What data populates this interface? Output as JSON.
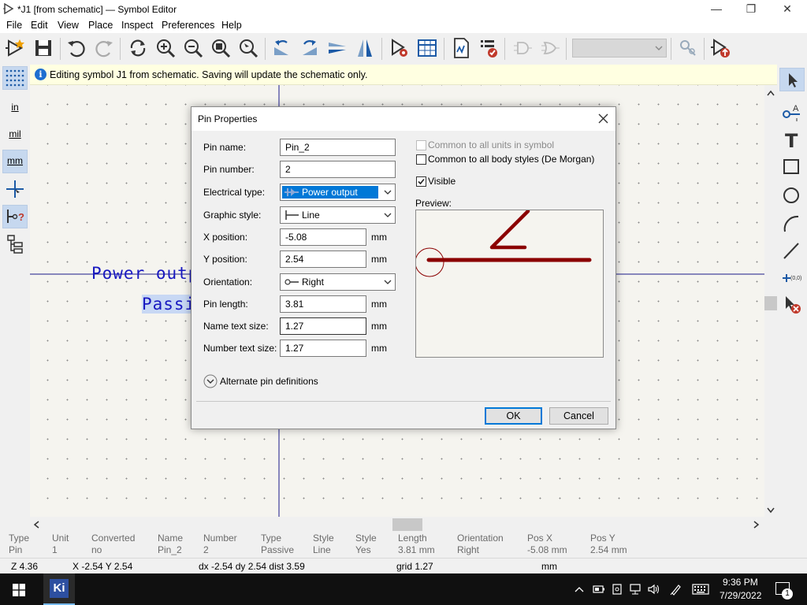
{
  "window": {
    "title": "*J1 [from schematic] — Symbol Editor",
    "controls": [
      "—",
      "❐",
      "✕"
    ]
  },
  "menu": [
    "File",
    "Edit",
    "View",
    "Place",
    "Inspect",
    "Preferences",
    "Help"
  ],
  "toolbar": {
    "unit_select_value": "",
    "icons": [
      "new-symbol-icon",
      "save-icon",
      "undo-icon",
      "redo-icon",
      "refresh-icon",
      "zoom-in-icon",
      "zoom-out-icon",
      "zoom-fit-icon",
      "zoom-tool-icon",
      "rotate-ccw-icon",
      "rotate-cw-icon",
      "mirror-v-icon",
      "mirror-h-icon",
      "symbol-properties-icon",
      "pin-table-icon",
      "datasheet-icon",
      "check-icon",
      "de-morgan-standard-icon",
      "de-morgan-alternate-icon",
      "sync-pins-icon",
      "update-schematic-icon"
    ]
  },
  "left_toolbar": {
    "grid_label": "",
    "inch_label": "in",
    "mil_label": "mil",
    "mm_label": "mm"
  },
  "infobar": {
    "icon": "i",
    "message": "Editing symbol J1 from schematic.  Saving will update the schematic only."
  },
  "canvas": {
    "pin_type_text": "Power outp",
    "pin_style_text": "Passi"
  },
  "dialog": {
    "title": "Pin Properties",
    "pin_name_label": "Pin name:",
    "pin_name_value": "Pin_2",
    "pin_number_label": "Pin number:",
    "pin_number_value": "2",
    "electrical_type_label": "Electrical type:",
    "electrical_type_value": "Power output",
    "graphic_style_label": "Graphic style:",
    "graphic_style_value": "Line",
    "x_position_label": "X position:",
    "x_position_value": "-5.08",
    "y_position_label": "Y position:",
    "y_position_value": "2.54",
    "orientation_label": "Orientation:",
    "orientation_value": "Right",
    "pin_length_label": "Pin length:",
    "pin_length_value": "3.81",
    "name_text_size_label": "Name text size:",
    "name_text_size_value": "1.27",
    "number_text_size_label": "Number text size:",
    "number_text_size_value": "1.27",
    "unit": "mm",
    "common_units_label": "Common to all units in symbol",
    "common_units_checked": false,
    "common_styles_label": "Common to all body styles (De Morgan)",
    "common_styles_checked": false,
    "visible_label": "Visible",
    "visible_checked": true,
    "preview_label": "Preview:",
    "alternate_label": "Alternate pin definitions",
    "ok_label": "OK",
    "cancel_label": "Cancel",
    "pin_color": "#8b0000"
  },
  "message_panel": {
    "columns": [
      {
        "header": "Type",
        "value": "Pin"
      },
      {
        "header": "Unit",
        "value": "1"
      },
      {
        "header": "Converted",
        "value": "no"
      },
      {
        "header": "Name",
        "value": "Pin_2"
      },
      {
        "header": "Number",
        "value": "2"
      },
      {
        "header": "Type",
        "value": "Passive"
      },
      {
        "header": "Style",
        "value": "Line"
      },
      {
        "header": "Style",
        "value": "Yes"
      },
      {
        "header": "Length",
        "value": "3.81 mm"
      },
      {
        "header": "Orientation",
        "value": "Right"
      },
      {
        "header": "Pos X",
        "value": "-5.08 mm"
      },
      {
        "header": "Pos Y",
        "value": "2.54 mm"
      }
    ]
  },
  "status": {
    "zoom": "Z 4.36",
    "cursor": "X -2.54  Y 2.54",
    "delta": "dx -2.54  dy 2.54  dist 3.59",
    "grid": "grid 1.27",
    "units": "mm"
  },
  "taskbar": {
    "time": "9:36 PM",
    "date": "7/29/2022",
    "app_label": "Ki",
    "notification_count": "1"
  }
}
